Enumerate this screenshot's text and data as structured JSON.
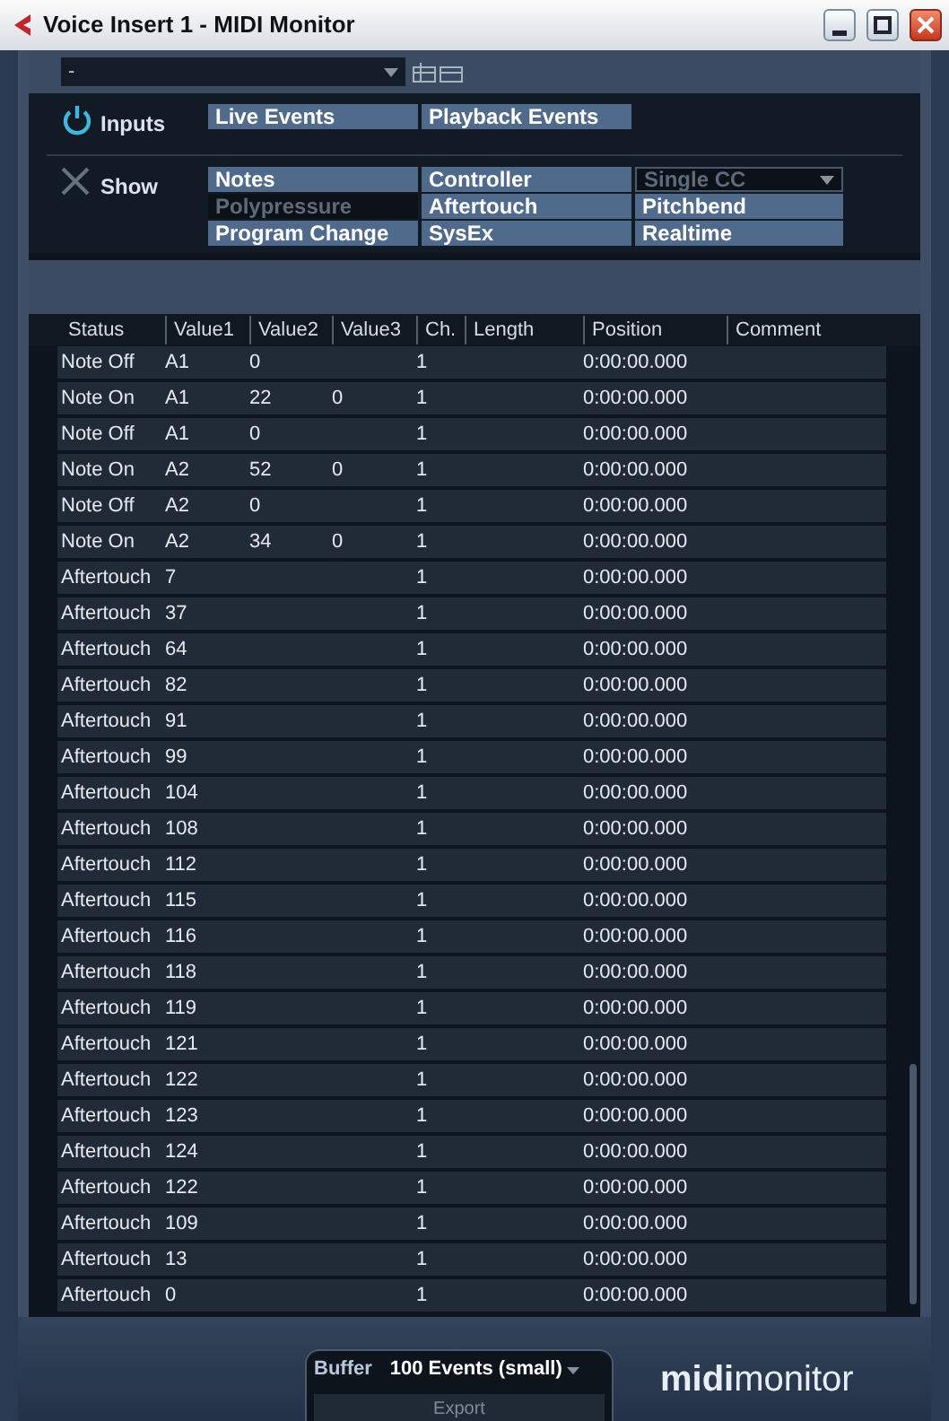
{
  "window": {
    "title": "Voice Insert 1 - MIDI Monitor"
  },
  "preset": {
    "value": "-"
  },
  "inputs": {
    "label": "Inputs",
    "on": true,
    "options": [
      {
        "label": "Live Events",
        "on": true
      },
      {
        "label": "Playback Events",
        "on": true
      }
    ]
  },
  "show": {
    "label": "Show",
    "options": [
      {
        "label": "Notes",
        "on": true,
        "kind": "toggle"
      },
      {
        "label": "Controller",
        "on": true,
        "kind": "toggle"
      },
      {
        "label": "Single CC",
        "on": false,
        "kind": "dropdown"
      },
      {
        "label": "Polypressure",
        "on": false,
        "kind": "toggle"
      },
      {
        "label": "Aftertouch",
        "on": true,
        "kind": "toggle"
      },
      {
        "label": "Pitchbend",
        "on": true,
        "kind": "toggle"
      },
      {
        "label": "Program Change",
        "on": true,
        "kind": "toggle"
      },
      {
        "label": "SysEx",
        "on": true,
        "kind": "toggle"
      },
      {
        "label": "Realtime",
        "on": true,
        "kind": "toggle"
      }
    ]
  },
  "table": {
    "columns": [
      "Status",
      "Value1",
      "Value2",
      "Value3",
      "Ch.",
      "Length",
      "Position",
      "Comment"
    ],
    "rows": [
      [
        "Note Off",
        "A1",
        "0",
        "",
        "1",
        "",
        "0:00:00.000",
        ""
      ],
      [
        "Note On",
        "A1",
        "22",
        "0",
        "1",
        "",
        "0:00:00.000",
        ""
      ],
      [
        "Note Off",
        "A1",
        "0",
        "",
        "1",
        "",
        "0:00:00.000",
        ""
      ],
      [
        "Note On",
        "A2",
        "52",
        "0",
        "1",
        "",
        "0:00:00.000",
        ""
      ],
      [
        "Note Off",
        "A2",
        "0",
        "",
        "1",
        "",
        "0:00:00.000",
        ""
      ],
      [
        "Note On",
        "A2",
        "34",
        "0",
        "1",
        "",
        "0:00:00.000",
        ""
      ],
      [
        "Aftertouch",
        "7",
        "",
        "",
        "1",
        "",
        "0:00:00.000",
        ""
      ],
      [
        "Aftertouch",
        "37",
        "",
        "",
        "1",
        "",
        "0:00:00.000",
        ""
      ],
      [
        "Aftertouch",
        "64",
        "",
        "",
        "1",
        "",
        "0:00:00.000",
        ""
      ],
      [
        "Aftertouch",
        "82",
        "",
        "",
        "1",
        "",
        "0:00:00.000",
        ""
      ],
      [
        "Aftertouch",
        "91",
        "",
        "",
        "1",
        "",
        "0:00:00.000",
        ""
      ],
      [
        "Aftertouch",
        "99",
        "",
        "",
        "1",
        "",
        "0:00:00.000",
        ""
      ],
      [
        "Aftertouch",
        "104",
        "",
        "",
        "1",
        "",
        "0:00:00.000",
        ""
      ],
      [
        "Aftertouch",
        "108",
        "",
        "",
        "1",
        "",
        "0:00:00.000",
        ""
      ],
      [
        "Aftertouch",
        "112",
        "",
        "",
        "1",
        "",
        "0:00:00.000",
        ""
      ],
      [
        "Aftertouch",
        "115",
        "",
        "",
        "1",
        "",
        "0:00:00.000",
        ""
      ],
      [
        "Aftertouch",
        "116",
        "",
        "",
        "1",
        "",
        "0:00:00.000",
        ""
      ],
      [
        "Aftertouch",
        "118",
        "",
        "",
        "1",
        "",
        "0:00:00.000",
        ""
      ],
      [
        "Aftertouch",
        "119",
        "",
        "",
        "1",
        "",
        "0:00:00.000",
        ""
      ],
      [
        "Aftertouch",
        "121",
        "",
        "",
        "1",
        "",
        "0:00:00.000",
        ""
      ],
      [
        "Aftertouch",
        "122",
        "",
        "",
        "1",
        "",
        "0:00:00.000",
        ""
      ],
      [
        "Aftertouch",
        "123",
        "",
        "",
        "1",
        "",
        "0:00:00.000",
        ""
      ],
      [
        "Aftertouch",
        "124",
        "",
        "",
        "1",
        "",
        "0:00:00.000",
        ""
      ],
      [
        "Aftertouch",
        "122",
        "",
        "",
        "1",
        "",
        "0:00:00.000",
        ""
      ],
      [
        "Aftertouch",
        "109",
        "",
        "",
        "1",
        "",
        "0:00:00.000",
        ""
      ],
      [
        "Aftertouch",
        "13",
        "",
        "",
        "1",
        "",
        "0:00:00.000",
        ""
      ],
      [
        "Aftertouch",
        "0",
        "",
        "",
        "1",
        "",
        "0:00:00.000",
        ""
      ]
    ]
  },
  "footer": {
    "buffer_label": "Buffer",
    "buffer_value": "100 Events (small)",
    "export": "Export",
    "logo": "**midi**monitor"
  }
}
